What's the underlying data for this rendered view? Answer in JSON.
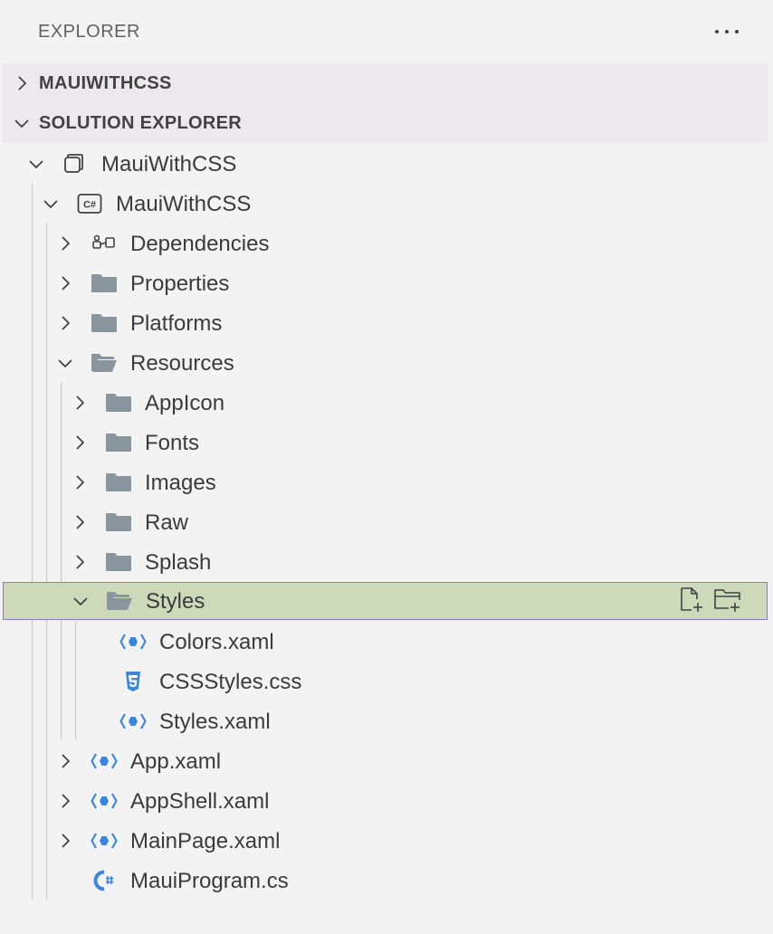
{
  "header": {
    "title": "EXPLORER",
    "more_icon": "ellipsis-icon"
  },
  "sections": {
    "mauiwithcss": {
      "label": "MAUIWITHCSS",
      "expanded": false
    },
    "solution_explorer": {
      "label": "SOLUTION EXPLORER",
      "expanded": true
    }
  },
  "tree": {
    "solution": {
      "label": "MauiWithCSS",
      "icon": "solution-icon"
    },
    "project": {
      "label": "MauiWithCSS",
      "icon": "csharp-project-icon"
    },
    "dependencies": {
      "label": "Dependencies",
      "icon": "dependencies-icon"
    },
    "properties": {
      "label": "Properties",
      "icon": "folder-icon"
    },
    "platforms": {
      "label": "Platforms",
      "icon": "folder-icon"
    },
    "resources": {
      "label": "Resources",
      "icon": "folder-open-icon"
    },
    "appicon": {
      "label": "AppIcon",
      "icon": "folder-icon"
    },
    "fonts": {
      "label": "Fonts",
      "icon": "folder-icon"
    },
    "images": {
      "label": "Images",
      "icon": "folder-icon"
    },
    "raw": {
      "label": "Raw",
      "icon": "folder-icon"
    },
    "splash": {
      "label": "Splash",
      "icon": "folder-icon"
    },
    "styles": {
      "label": "Styles",
      "icon": "folder-open-icon",
      "selected": true
    },
    "colors_xaml": {
      "label": "Colors.xaml",
      "icon": "xaml-icon"
    },
    "cssstyles_css": {
      "label": "CSSStyles.css",
      "icon": "css-icon"
    },
    "styles_xaml": {
      "label": "Styles.xaml",
      "icon": "xaml-icon"
    },
    "app_xaml": {
      "label": "App.xaml",
      "icon": "xaml-icon"
    },
    "appshell_xaml": {
      "label": "AppShell.xaml",
      "icon": "xaml-icon"
    },
    "mainpage_xaml": {
      "label": "MainPage.xaml",
      "icon": "xaml-icon"
    },
    "mauiprogram_cs": {
      "label": "MauiProgram.cs",
      "icon": "csharp-file-icon"
    }
  },
  "row_actions": {
    "new_file_icon": "new-file-icon",
    "new_folder_icon": "new-folder-icon"
  },
  "colors": {
    "background": "#f3f3f3",
    "section_header": "#ece8ee",
    "selection": "#cdd9b8",
    "selection_border": "#9474d9",
    "folder": "#8a969e",
    "xaml": "#3b87e0"
  }
}
